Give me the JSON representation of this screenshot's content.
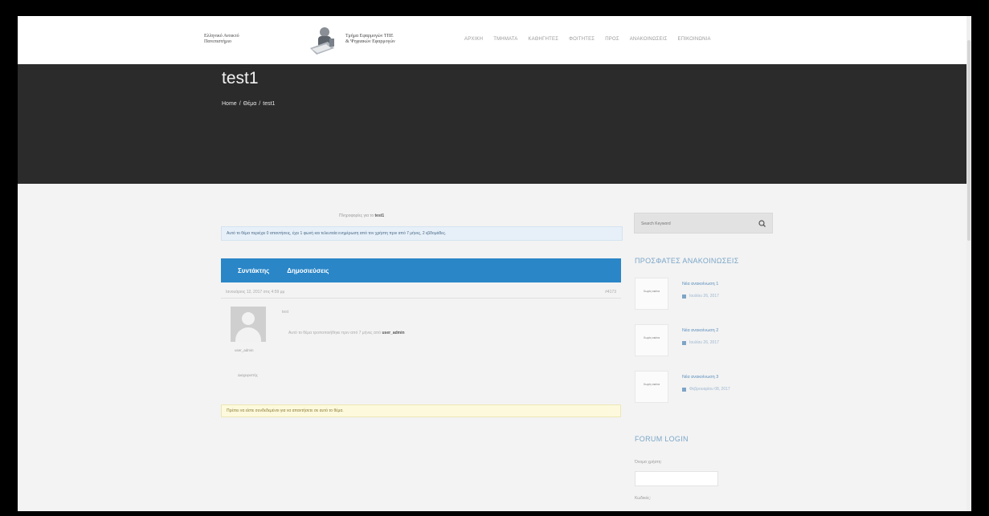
{
  "header": {
    "logo_left_line1": "Ελληνικό Ανοικτό",
    "logo_left_line2": "Πανεπιστήμιο",
    "logo_right_line1": "Τμήμα Εφαρμογών ΤΠΕ",
    "logo_right_line2": "& Ψηφιακών Εφαρμογών",
    "nav": [
      "ΑΡΧΙΚΗ",
      "ΤΜΗΜΑΤΑ",
      "ΚΑΘΗΓΗΤΕΣ",
      "ΦΟΙΤΗΤΕΣ",
      "ΠΡΟΣ",
      "ΑΝΑΚΟΙΝΩΣΕΙΣ",
      "ΕΠΙΚΟΙΝΩΝΙΑ"
    ]
  },
  "page": {
    "title": "test1",
    "breadcrumb": [
      "Home",
      "/",
      "Θέμα",
      "/",
      "test1"
    ]
  },
  "content": {
    "subscribe_text": "Πληροφορίες για το",
    "subscribe_link": "test1",
    "info_notice": "Αυτό το θέμα περιέχει 0 απαντήσεις, έχει 1 φωνή και τελευταία ενημέρωση από τον χρήστη πριν από 7 μήνες, 2 εβδομάδες.",
    "topic_header": {
      "author_label": "Συντάκτης",
      "posts_label": "Δημοσιεύσεις"
    },
    "post": {
      "date": "Ιανουάριος 12, 2017 στις 4:59 μμ",
      "number": "#4173",
      "text": "test",
      "signature_text": "Αυτό το θέμα τροποποιήθηκε πριν από 7 μήνες από",
      "signature_user": "user_admin",
      "author": "user_admin",
      "role": "Διαχειριστής"
    },
    "warning_notice": "Πρέπει να είστε συνδεδεμένοι για να απαντήσετε σε αυτό το θέμα."
  },
  "sidebar": {
    "search_placeholder": "Search Keyword",
    "recent_title": "ΠΡΟΣΦΑΤΕΣ ΑΝΑΚΟΙΝΩΣΕΙΣ",
    "recent": [
      {
        "thumb": "Χωρίς εικόνα",
        "title": "Νέα ανακοίνωση 1",
        "date": "Ιουλίου 26, 2017"
      },
      {
        "thumb": "Χωρίς εικόνα",
        "title": "Νέα ανακοίνωση 2",
        "date": "Ιουλίου 26, 2017"
      },
      {
        "thumb": "Χωρίς εικόνα",
        "title": "Νέα ανακοίνωση 3",
        "date": "Φεβρουαρίου 08, 2017"
      }
    ],
    "login_title": "FORUM LOGIN",
    "username_label": "Όνομα χρήστη:",
    "password_label": "Κωδικός:"
  }
}
